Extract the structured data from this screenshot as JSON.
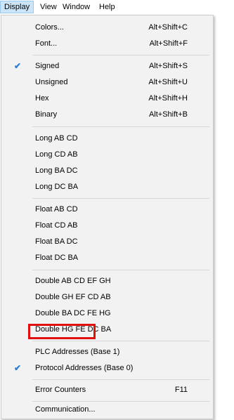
{
  "menubar": {
    "items": [
      {
        "label": "Display"
      },
      {
        "label": "View"
      },
      {
        "label": "Window"
      },
      {
        "label": "Help"
      }
    ]
  },
  "display_menu": {
    "items": [
      {
        "label": "Colors...",
        "shortcut": "Alt+Shift+C",
        "checked": false
      },
      {
        "label": "Font...",
        "shortcut": "Alt+Shift+F",
        "checked": false
      },
      {
        "label": "Signed",
        "shortcut": "Alt+Shift+S",
        "checked": true
      },
      {
        "label": "Unsigned",
        "shortcut": "Alt+Shift+U",
        "checked": false
      },
      {
        "label": "Hex",
        "shortcut": "Alt+Shift+H",
        "checked": false
      },
      {
        "label": "Binary",
        "shortcut": "Alt+Shift+B",
        "checked": false
      },
      {
        "label": "Long AB CD",
        "shortcut": "",
        "checked": false
      },
      {
        "label": "Long CD AB",
        "shortcut": "",
        "checked": false
      },
      {
        "label": "Long BA DC",
        "shortcut": "",
        "checked": false
      },
      {
        "label": "Long DC BA",
        "shortcut": "",
        "checked": false
      },
      {
        "label": "Float AB CD",
        "shortcut": "",
        "checked": false,
        "highlighted": true
      },
      {
        "label": "Float CD AB",
        "shortcut": "",
        "checked": false
      },
      {
        "label": "Float BA DC",
        "shortcut": "",
        "checked": false
      },
      {
        "label": "Float DC BA",
        "shortcut": "",
        "checked": false
      },
      {
        "label": "Double AB CD EF GH",
        "shortcut": "",
        "checked": false
      },
      {
        "label": "Double GH EF CD AB",
        "shortcut": "",
        "checked": false
      },
      {
        "label": "Double BA DC FE HG",
        "shortcut": "",
        "checked": false
      },
      {
        "label": "Double HG FE DC BA",
        "shortcut": "",
        "checked": false
      },
      {
        "label": "PLC Addresses (Base 1)",
        "shortcut": "",
        "checked": false
      },
      {
        "label": "Protocol Addresses (Base 0)",
        "shortcut": "",
        "checked": true
      },
      {
        "label": "Error Counters",
        "shortcut": "F11",
        "checked": false
      },
      {
        "label": "Communication...",
        "shortcut": "",
        "checked": false
      }
    ]
  },
  "colors": {
    "check": "#2e7dd1",
    "highlight_border": "#e01010",
    "active_menubar": "#cce4f7"
  },
  "icons": {
    "checkmark": "checkmark-icon"
  }
}
